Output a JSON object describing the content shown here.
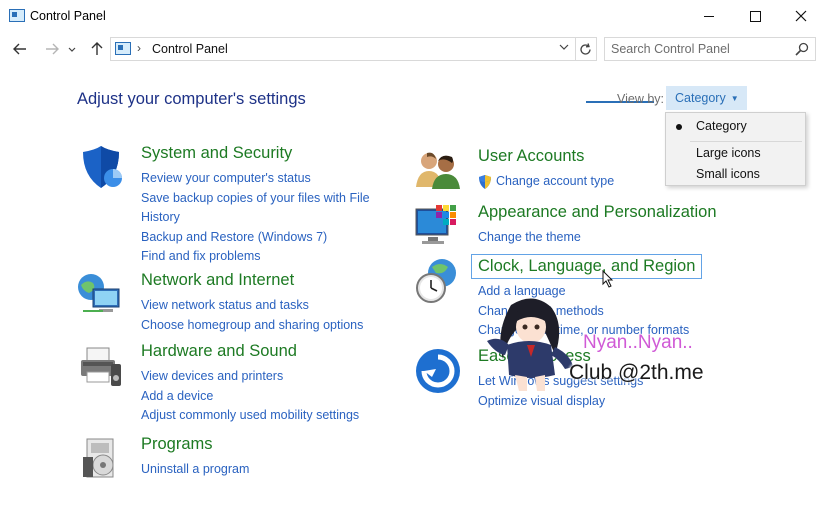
{
  "window": {
    "title": "Control Panel"
  },
  "address": {
    "crumb": "Control Panel",
    "search_placeholder": "Search Control Panel"
  },
  "main": {
    "heading": "Adjust your computer's settings",
    "view_by_label": "View by:",
    "view_by_value": "Category",
    "view_options": [
      "Category",
      "Large icons",
      "Small icons"
    ]
  },
  "categories": [
    {
      "title": "System and Security",
      "icon": "shield-icon",
      "links": [
        "Review your computer's status",
        "Save backup copies of your files with File",
        "History",
        "Backup and Restore (Windows 7)",
        "Find and fix problems"
      ]
    },
    {
      "title": "Network and Internet",
      "icon": "network-globe-icon",
      "links": [
        "View network status and tasks",
        "Choose homegroup and sharing options"
      ]
    },
    {
      "title": "Hardware and Sound",
      "icon": "printer-icon",
      "links": [
        "View devices and printers",
        "Add a device",
        "Adjust commonly used mobility settings"
      ]
    },
    {
      "title": "Programs",
      "icon": "programs-icon",
      "links": [
        "Uninstall a program"
      ]
    },
    {
      "title": "User Accounts",
      "icon": "users-icon",
      "links": [
        "Change account type"
      ]
    },
    {
      "title": "Appearance and Personalization",
      "icon": "monitor-colors-icon",
      "links": [
        "Change the theme"
      ]
    },
    {
      "title": "Clock, Language, and Region",
      "icon": "clock-globe-icon",
      "links": [
        "Add a language",
        "Change input methods",
        "Change date, time, or number formats"
      ]
    },
    {
      "title": "Ease of Access",
      "icon": "ease-of-access-icon",
      "links": [
        "Let Windows suggest settings",
        "Optimize visual display"
      ]
    }
  ],
  "watermark": {
    "line1": "Nyan..Nyan..",
    "line2": "Club @2th.me"
  },
  "colors": {
    "heading": "#1e3287",
    "category_title": "#1d7a23",
    "link": "#2a62c0",
    "accent": "#2a6fb7",
    "watermark_pink": "#d05ad6"
  }
}
